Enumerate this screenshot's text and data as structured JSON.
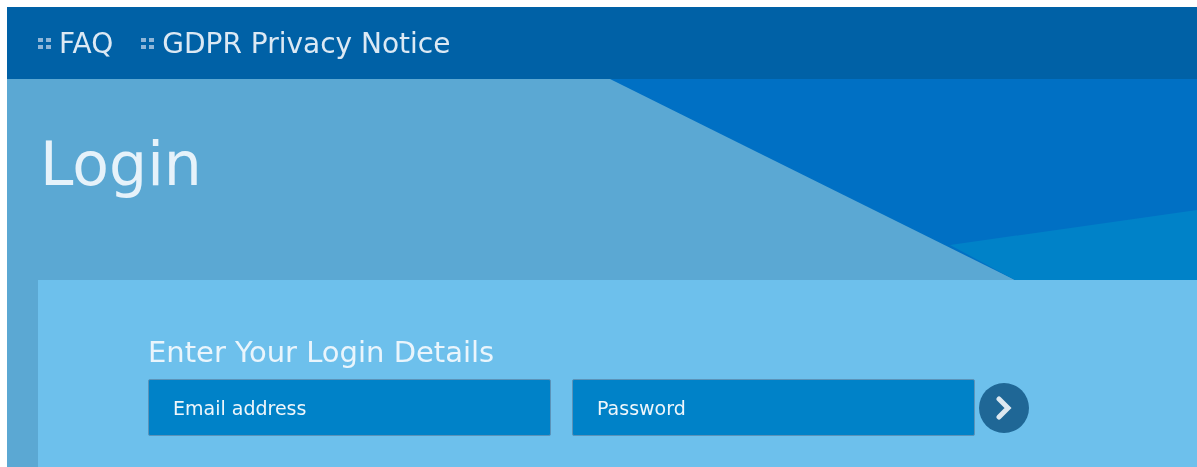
{
  "nav": {
    "links": [
      {
        "label": "FAQ"
      },
      {
        "label": "GDPR Privacy Notice"
      }
    ]
  },
  "hero": {
    "title": "Login"
  },
  "login_form": {
    "heading": "Enter Your Login Details",
    "fields": [
      {
        "placeholder": "Email address"
      },
      {
        "placeholder": "Password"
      }
    ]
  }
}
